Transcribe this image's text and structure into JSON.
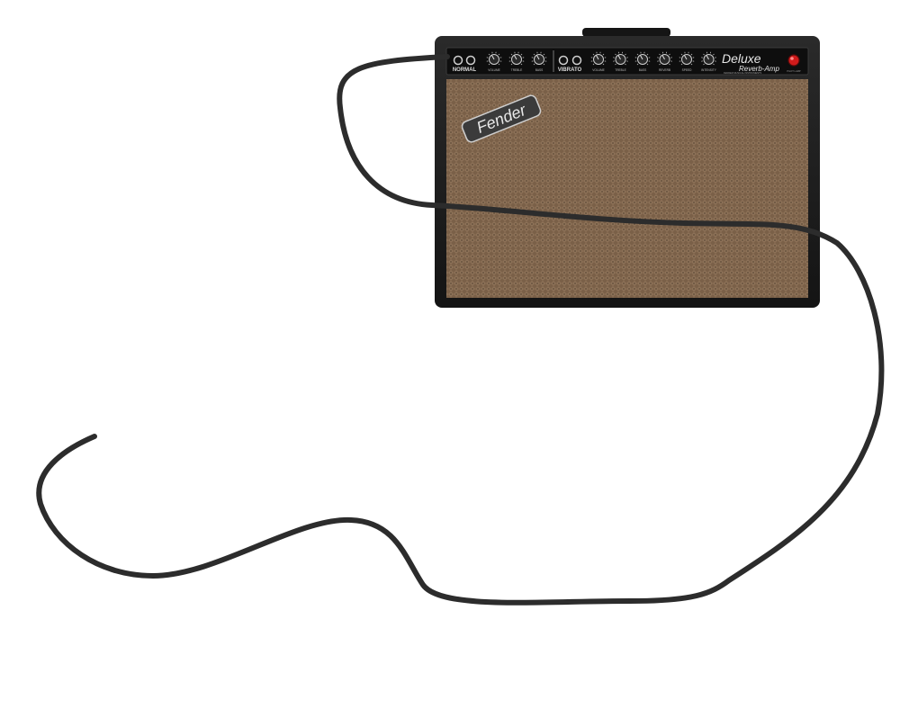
{
  "amp": {
    "brand_logo": "Fender",
    "model_line1": "Deluxe",
    "model_line2": "Reverb-Amp",
    "subtitle": "FENDER MUSICAL INSTRUMENTS",
    "pilot_label": "PILOT LAMP",
    "normal_channel": {
      "label": "NORMAL",
      "knobs": [
        "VOLUME",
        "TREBLE",
        "BASS"
      ]
    },
    "vibrato_channel": {
      "label": "VIBRATO",
      "knobs": [
        "VOLUME",
        "TREBLE",
        "BASS",
        "REVERB",
        "SPEED",
        "INTENSITY"
      ]
    },
    "colors": {
      "tolex": "#1b1b1b",
      "panel": "#101010",
      "grill": "#7a6048",
      "grill_weave": "#8d7258",
      "knob": "#2a2a2a",
      "jewel": "#d01b1b",
      "cable": "#2c2c2c"
    }
  },
  "icons": {
    "logo": "fender-script-logo",
    "jack": "input-jack-icon",
    "knob": "control-knob-icon",
    "lamp": "pilot-jewel-lamp-icon"
  }
}
